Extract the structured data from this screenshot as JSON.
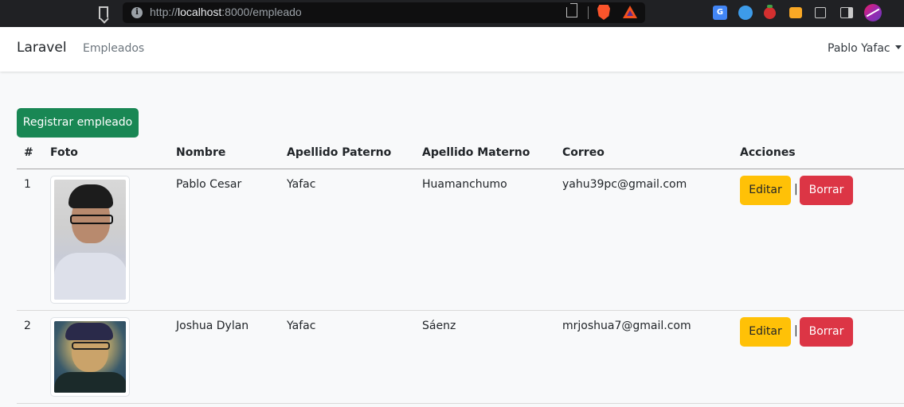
{
  "browser": {
    "url_prefix": "http://",
    "url_host": "localhost",
    "url_rest": ":8000/empleado",
    "translate_icon_text": "G"
  },
  "navbar": {
    "brand": "Laravel",
    "link": "Empleados",
    "user": "Pablo Yafac"
  },
  "actions": {
    "register_label": "Registrar empleado"
  },
  "table": {
    "headers": [
      "#",
      "Foto",
      "Nombre",
      "Apellido Paterno",
      "Apellido Materno",
      "Correo",
      "Acciones"
    ],
    "rows": [
      {
        "id": "1",
        "nombre": "Pablo Cesar",
        "apellido_paterno": "Yafac",
        "apellido_materno": "Huamanchumo",
        "correo": "yahu39pc@gmail.com",
        "edit_label": "Editar",
        "separator": "|",
        "delete_label": "Borrar"
      },
      {
        "id": "2",
        "nombre": "Joshua Dylan",
        "apellido_paterno": "Yafac",
        "apellido_materno": "Sáenz",
        "correo": "mrjoshua7@gmail.com",
        "edit_label": "Editar",
        "separator": "|",
        "delete_label": "Borrar"
      }
    ]
  },
  "icons": [
    "bookmark-icon",
    "info-icon",
    "share-icon",
    "brave-shield-icon",
    "bat-rewards-icon",
    "google-translate-icon",
    "extension-blue-icon",
    "tomato-extension-icon",
    "extension-yellow-icon",
    "puzzle-icon",
    "sidebar-icon",
    "profile-avatar-icon",
    "caret-down-icon"
  ],
  "colors": {
    "success": "#198754",
    "warning": "#ffc107",
    "danger": "#dc3545",
    "page_bg": "#f8f9fa",
    "chrome_bg": "#202124"
  }
}
